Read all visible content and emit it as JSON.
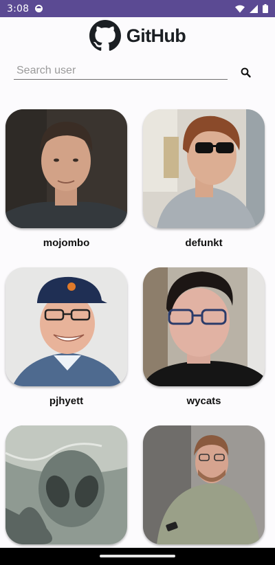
{
  "status_bar": {
    "time": "3:08",
    "icons": [
      "app-notification-icon",
      "wifi-icon",
      "cellular-icon",
      "battery-icon"
    ]
  },
  "header": {
    "title": "GitHub",
    "logo_icon": "github-octocat-icon"
  },
  "search": {
    "placeholder": "Search user",
    "value": "",
    "icon": "search-icon"
  },
  "users": [
    {
      "login": "mojombo",
      "avatar": "person-photo"
    },
    {
      "login": "defunkt",
      "avatar": "person-photo"
    },
    {
      "login": "pjhyett",
      "avatar": "person-photo"
    },
    {
      "login": "wycats",
      "avatar": "person-photo"
    },
    {
      "login": "",
      "avatar": "alien-artwork"
    },
    {
      "login": "",
      "avatar": "person-photo"
    }
  ],
  "colors": {
    "status_bar": "#5b4a93",
    "background": "#fcfbfd",
    "text": "#111111"
  }
}
